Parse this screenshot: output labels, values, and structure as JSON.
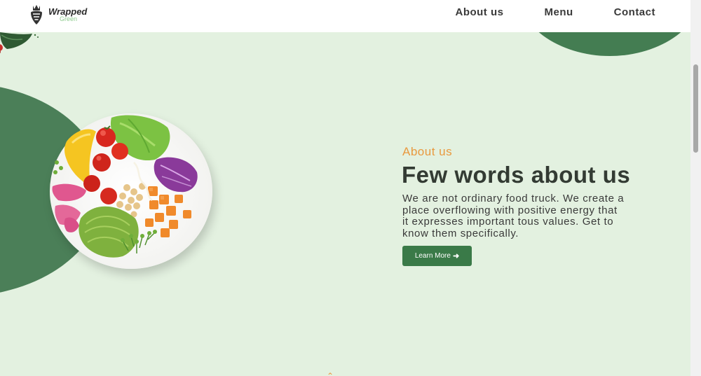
{
  "header": {
    "logo": {
      "word": "Wrapped",
      "sub": "Green",
      "icon": "beet-logo-icon"
    },
    "nav": [
      {
        "label": "About us"
      },
      {
        "label": "Menu"
      },
      {
        "label": "Contact"
      }
    ]
  },
  "about": {
    "eyebrow": "About us",
    "headline": "Few words about us",
    "body": "We are not ordinary food truck. We create a place overflowing with positive energy that it expresses important tous values. Get to know them specifically.",
    "button_label": "Learn More",
    "button_icon": "arrow-right-icon"
  },
  "colors": {
    "background": "#e3f1e0",
    "primary_green": "#3a7a48",
    "accent_orange": "#e9993e",
    "text_dark": "#333b33"
  }
}
